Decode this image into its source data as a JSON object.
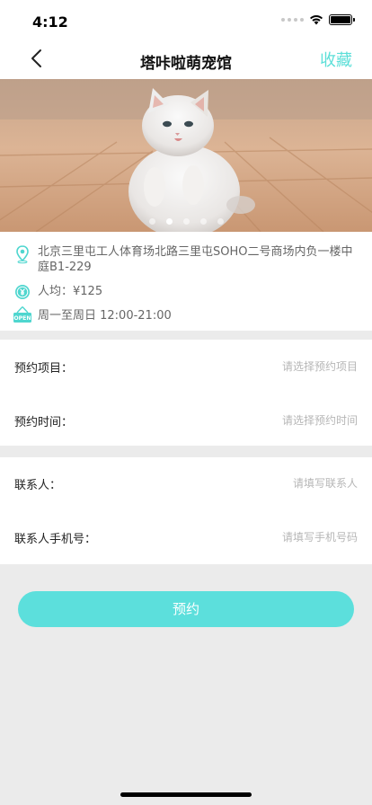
{
  "status_bar": {
    "time": "4:12"
  },
  "nav": {
    "title": "塔咔啦萌宠馆",
    "favorite_label": "收藏"
  },
  "banner": {
    "slide_count": 5,
    "active_index": 1
  },
  "info": {
    "address": "北京三里屯工人体育场北路三里屯SOHO二号商场内负一楼中庭B1-229",
    "avg_price": "人均：¥125",
    "hours": "周一至周日 12:00-21:00",
    "open_badge": "OPEN"
  },
  "booking": {
    "item_label": "预约项目：",
    "item_placeholder": "请选择预约项目",
    "time_label": "预约时间：",
    "time_placeholder": "请选择预约时间"
  },
  "contact": {
    "name_label": "联系人：",
    "name_placeholder": "请填写联系人",
    "phone_label": "联系人手机号：",
    "phone_placeholder": "请填写手机号码"
  },
  "submit_label": "预约",
  "colors": {
    "accent": "#5cdfdc",
    "background": "#ebebeb"
  }
}
